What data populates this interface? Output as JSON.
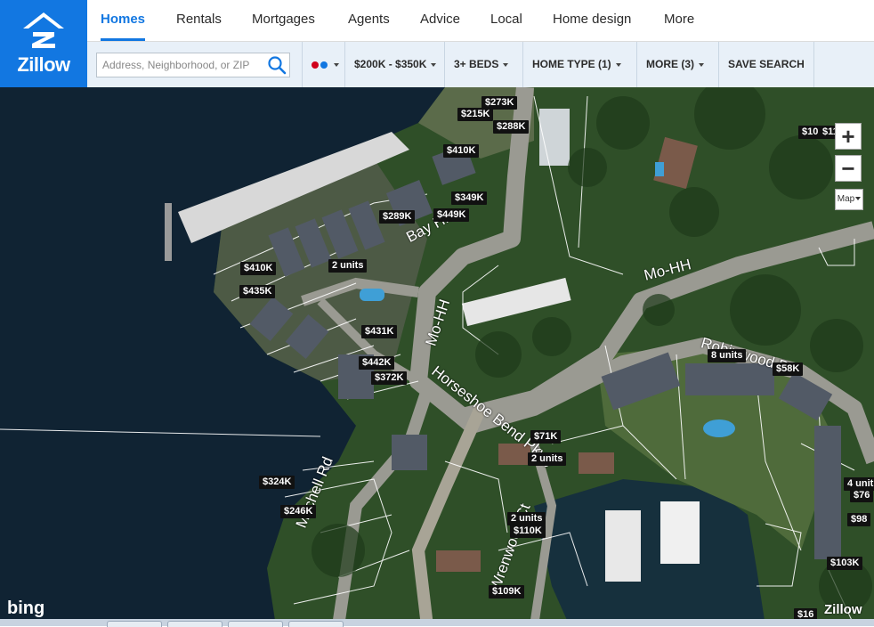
{
  "logo": {
    "text": "Zillow"
  },
  "nav": {
    "tabs": [
      "Homes",
      "Rentals",
      "Mortgages",
      "Agents",
      "Advice",
      "Local",
      "Home design",
      "More"
    ]
  },
  "search": {
    "placeholder": "Address, Neighborhood, or ZIP"
  },
  "filters": {
    "price": "$200K - $350K",
    "beds": "3+ BEDS",
    "home_type": "HOME TYPE (1)",
    "more": "MORE (3)",
    "save": "SAVE SEARCH",
    "status_colors": [
      "#d0021b",
      "#1277e1"
    ]
  },
  "map": {
    "streets": [
      "Bay Hill",
      "Mo-HH",
      "Mo-HH",
      "Horseshoe Bend Pkwy",
      "Robinwood Dr",
      "Mitchell Rd",
      "Wrenwood Ct"
    ],
    "prices": [
      "$273K",
      "$215K",
      "$288K",
      "$410K",
      "$349K",
      "$289K",
      "$449K",
      "2 units",
      "$410K",
      "$435K",
      "$431K",
      "$442K",
      "$372K",
      "8 units",
      "$58K",
      "$71K",
      "2 units",
      "$324K",
      "$246K",
      "2 units",
      "$110K",
      "$109K",
      "$103K",
      "$10",
      "$11",
      "4 unit",
      "$76",
      "$98",
      "$16"
    ],
    "controls": {
      "zoom_in": "+",
      "zoom_out": "−",
      "map_type": "Map"
    },
    "attribution": "bing",
    "watermark": "Zillow"
  }
}
